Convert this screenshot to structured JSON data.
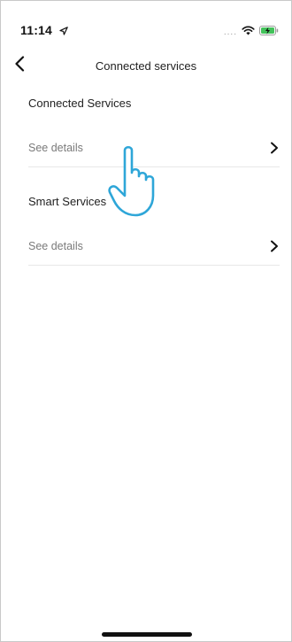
{
  "status_bar": {
    "time": "11:14",
    "location_icon": "location-arrow-icon",
    "signal_icon": "signal-dots-icon",
    "wifi_icon": "wifi-icon",
    "battery_icon": "battery-charging-icon",
    "battery_color": "#43c25a"
  },
  "nav": {
    "back_icon": "chevron-left-icon",
    "title": "Connected services"
  },
  "sections": [
    {
      "heading": "Connected Services",
      "row_label": "See details",
      "row_icon": "chevron-right-icon"
    },
    {
      "heading": "Smart Services",
      "row_label": "See details",
      "row_icon": "chevron-right-icon"
    }
  ],
  "overlay": {
    "hand_icon": "pointing-hand-icon",
    "hand_color": "#2ea6d8"
  }
}
